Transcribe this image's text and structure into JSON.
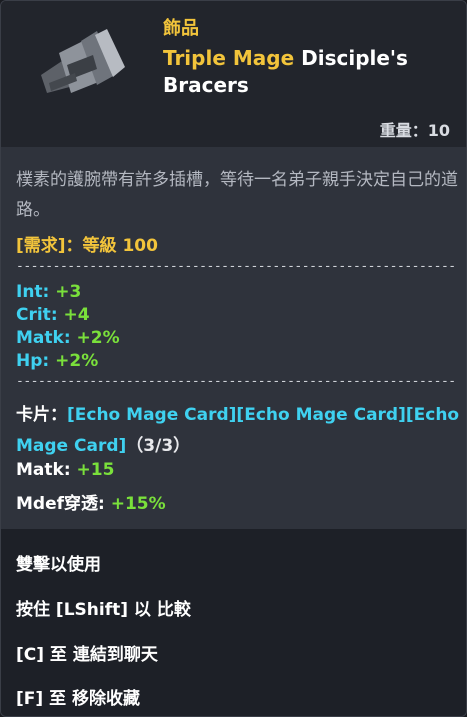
{
  "header": {
    "category": "飾品",
    "title_highlight": "Triple Mage",
    "title_rest": " Disciple's Bracers",
    "weight": "重量：10",
    "item_icon": "bracer-icon"
  },
  "body": {
    "description": "樸素的護腕帶有許多插槽，等待一名弟子親手決定自己的道路。",
    "requirement": "[需求]：等級 100",
    "separator": "-----------------------------------------------------------------------",
    "stats": [
      {
        "key": "Int: ",
        "value": "+3"
      },
      {
        "key": "Crit: ",
        "value": "+4"
      },
      {
        "key": "Matk: ",
        "value": "+2%"
      },
      {
        "key": "Hp: ",
        "value": "+2%"
      }
    ],
    "cards_label": "卡片：",
    "cards_names": "[Echo Mage Card][Echo Mage Card][Echo Mage Card]",
    "cards_count": "（3/3）",
    "bonuses": [
      {
        "key": "Matk: ",
        "value": "+15"
      },
      {
        "key": "Mdef穿透: ",
        "value": "+15%"
      }
    ]
  },
  "actions": [
    "雙擊以使用",
    "按住 [LShift] 以 比較",
    "[C] 至 連結到聊天",
    "[F] 至 移除收藏"
  ],
  "colors": {
    "gold": "#f2c43b",
    "cyan": "#3fd1f0",
    "green": "#7ae03b"
  }
}
